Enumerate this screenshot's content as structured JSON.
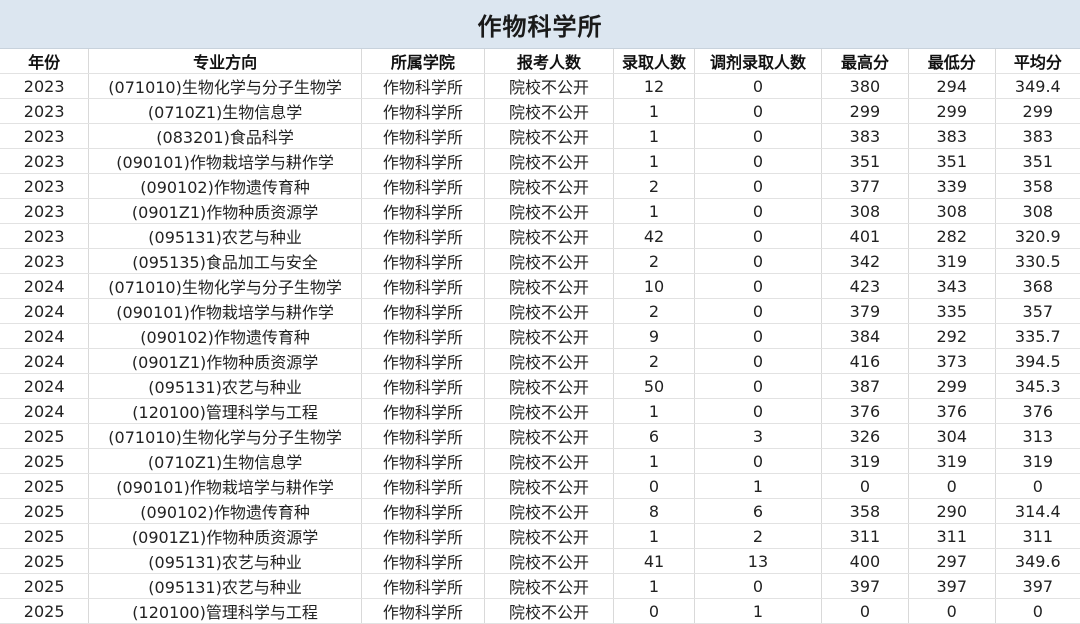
{
  "title": "作物科学所",
  "headers": [
    "年份",
    "专业方向",
    "所属学院",
    "报考人数",
    "录取人数",
    "调剂录取人数",
    "最高分",
    "最低分",
    "平均分"
  ],
  "rows": [
    [
      "2023",
      "(071010)生物化学与分子生物学",
      "作物科学所",
      "院校不公开",
      "12",
      "0",
      "380",
      "294",
      "349.4"
    ],
    [
      "2023",
      "(0710Z1)生物信息学",
      "作物科学所",
      "院校不公开",
      "1",
      "0",
      "299",
      "299",
      "299"
    ],
    [
      "2023",
      "(083201)食品科学",
      "作物科学所",
      "院校不公开",
      "1",
      "0",
      "383",
      "383",
      "383"
    ],
    [
      "2023",
      "(090101)作物栽培学与耕作学",
      "作物科学所",
      "院校不公开",
      "1",
      "0",
      "351",
      "351",
      "351"
    ],
    [
      "2023",
      "(090102)作物遗传育种",
      "作物科学所",
      "院校不公开",
      "2",
      "0",
      "377",
      "339",
      "358"
    ],
    [
      "2023",
      "(0901Z1)作物种质资源学",
      "作物科学所",
      "院校不公开",
      "1",
      "0",
      "308",
      "308",
      "308"
    ],
    [
      "2023",
      "(095131)农艺与种业",
      "作物科学所",
      "院校不公开",
      "42",
      "0",
      "401",
      "282",
      "320.9"
    ],
    [
      "2023",
      "(095135)食品加工与安全",
      "作物科学所",
      "院校不公开",
      "2",
      "0",
      "342",
      "319",
      "330.5"
    ],
    [
      "2024",
      "(071010)生物化学与分子生物学",
      "作物科学所",
      "院校不公开",
      "10",
      "0",
      "423",
      "343",
      "368"
    ],
    [
      "2024",
      "(090101)作物栽培学与耕作学",
      "作物科学所",
      "院校不公开",
      "2",
      "0",
      "379",
      "335",
      "357"
    ],
    [
      "2024",
      "(090102)作物遗传育种",
      "作物科学所",
      "院校不公开",
      "9",
      "0",
      "384",
      "292",
      "335.7"
    ],
    [
      "2024",
      "(0901Z1)作物种质资源学",
      "作物科学所",
      "院校不公开",
      "2",
      "0",
      "416",
      "373",
      "394.5"
    ],
    [
      "2024",
      "(095131)农艺与种业",
      "作物科学所",
      "院校不公开",
      "50",
      "0",
      "387",
      "299",
      "345.3"
    ],
    [
      "2024",
      "(120100)管理科学与工程",
      "作物科学所",
      "院校不公开",
      "1",
      "0",
      "376",
      "376",
      "376"
    ],
    [
      "2025",
      "(071010)生物化学与分子生物学",
      "作物科学所",
      "院校不公开",
      "6",
      "3",
      "326",
      "304",
      "313"
    ],
    [
      "2025",
      "(0710Z1)生物信息学",
      "作物科学所",
      "院校不公开",
      "1",
      "0",
      "319",
      "319",
      "319"
    ],
    [
      "2025",
      "(090101)作物栽培学与耕作学",
      "作物科学所",
      "院校不公开",
      "0",
      "1",
      "0",
      "0",
      "0"
    ],
    [
      "2025",
      "(090102)作物遗传育种",
      "作物科学所",
      "院校不公开",
      "8",
      "6",
      "358",
      "290",
      "314.4"
    ],
    [
      "2025",
      "(0901Z1)作物种质资源学",
      "作物科学所",
      "院校不公开",
      "1",
      "2",
      "311",
      "311",
      "311"
    ],
    [
      "2025",
      "(095131)农艺与种业",
      "作物科学所",
      "院校不公开",
      "41",
      "13",
      "400",
      "297",
      "349.6"
    ],
    [
      "2025",
      "(095131)农艺与种业",
      "作物科学所",
      "院校不公开",
      "1",
      "0",
      "397",
      "397",
      "397"
    ],
    [
      "2025",
      "(120100)管理科学与工程",
      "作物科学所",
      "院校不公开",
      "0",
      "1",
      "0",
      "0",
      "0"
    ]
  ]
}
